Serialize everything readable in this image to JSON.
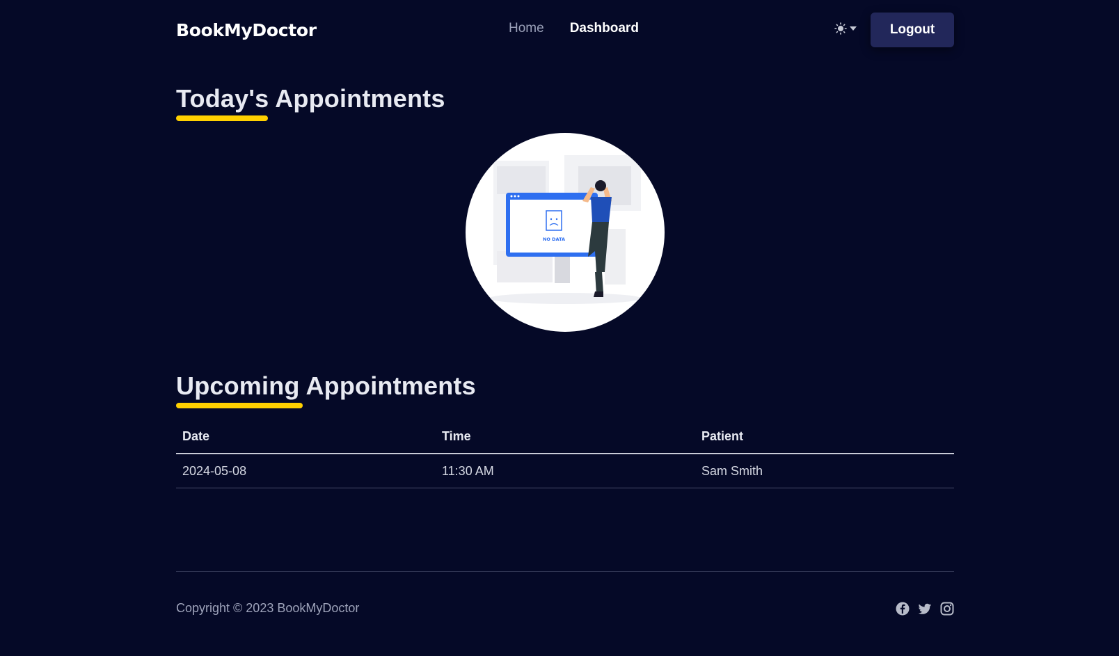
{
  "header": {
    "brand": "BookMyDoctor",
    "nav": [
      {
        "label": "Home"
      },
      {
        "label": "Dashboard"
      }
    ],
    "theme_toggle_icon": "sun-icon",
    "logout_label": "Logout"
  },
  "today": {
    "title_first": "Today's",
    "title_rest": " Appointments",
    "empty_illustration_text": "NO DATA"
  },
  "upcoming": {
    "title_first": "Upcoming",
    "title_rest": " Appointments",
    "columns": [
      "Date",
      "Time",
      "Patient"
    ],
    "rows": [
      {
        "date": "2024-05-08",
        "time": "11:30 AM",
        "patient": "Sam Smith"
      }
    ]
  },
  "footer": {
    "copyright": "Copyright © 2023 BookMyDoctor",
    "social_icons": [
      "facebook-icon",
      "twitter-icon",
      "instagram-icon"
    ]
  },
  "colors": {
    "background": "#050927",
    "accent_underline": "#ffd000",
    "logout_button": "#22275a"
  }
}
